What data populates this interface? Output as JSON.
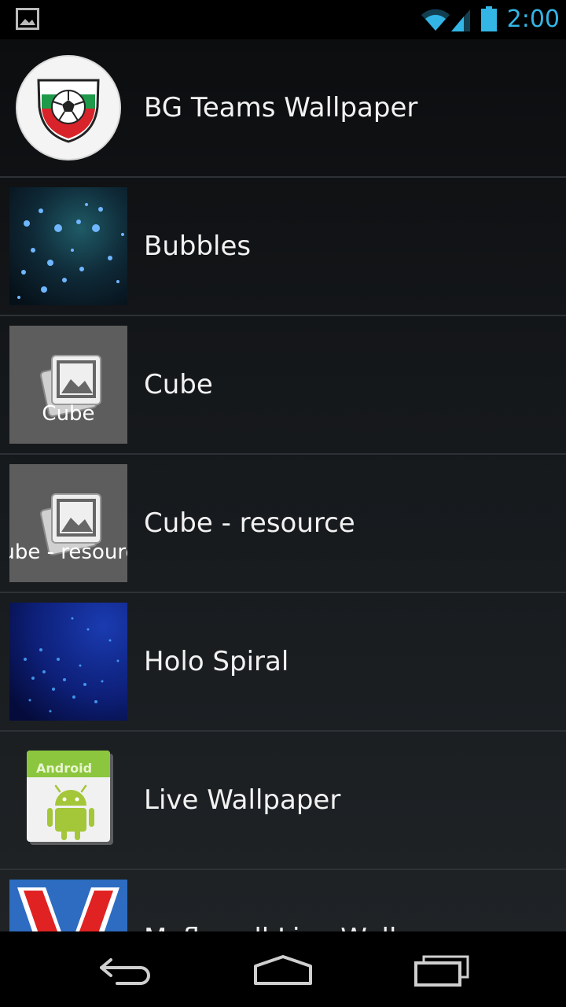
{
  "status_bar": {
    "time": "2:00",
    "accent_color": "#33b5e5",
    "icons": [
      "gallery-notification-icon",
      "wifi-icon",
      "cell-signal-icon",
      "battery-icon"
    ]
  },
  "wallpapers": [
    {
      "label": "BG Teams Wallpaper",
      "icon": "soccer-shield-icon"
    },
    {
      "label": "Bubbles",
      "icon": "bubbles-thumbnail"
    },
    {
      "label": "Cube",
      "icon": "placeholder-picture-icon",
      "thumb_caption": "Cube"
    },
    {
      "label": "Cube - resource",
      "icon": "placeholder-picture-icon",
      "thumb_caption": "Cube - resource"
    },
    {
      "label": "Holo Spiral",
      "icon": "holo-spiral-thumbnail"
    },
    {
      "label": "Live Wallpaper",
      "icon": "android-package-icon",
      "thumb_caption": "Android"
    },
    {
      "label": "Myflowall Live Wallpaper",
      "icon": "red-v-logo-icon"
    }
  ],
  "nav_bar": {
    "buttons": [
      "back",
      "home",
      "recents"
    ]
  }
}
